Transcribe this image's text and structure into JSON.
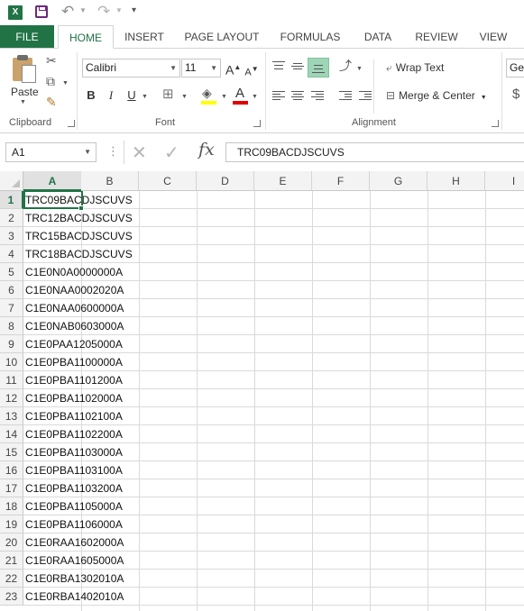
{
  "app": {
    "logo": "X"
  },
  "ribbon_tabs": [
    {
      "label": "FILE"
    },
    {
      "label": "HOME"
    },
    {
      "label": "INSERT"
    },
    {
      "label": "PAGE LAYOUT"
    },
    {
      "label": "FORMULAS"
    },
    {
      "label": "DATA"
    },
    {
      "label": "REVIEW"
    },
    {
      "label": "VIEW"
    }
  ],
  "clipboard": {
    "paste_label": "Paste",
    "group_label": "Clipboard"
  },
  "font": {
    "name": "Calibri",
    "size": "11",
    "group_label": "Font",
    "bold": "B",
    "italic": "I",
    "underline": "U",
    "grow": "A",
    "shrink": "A",
    "font_color_letter": "A",
    "highlight_color": "#ffff00",
    "font_color": "#e00000"
  },
  "alignment": {
    "wrap_text": "Wrap Text",
    "merge_center": "Merge & Center",
    "group_label": "Alignment"
  },
  "number": {
    "format": "General",
    "currency": "$"
  },
  "formula_bar": {
    "name_box": "A1",
    "fx": "fx",
    "value": "TRC09BACDJSCUVS"
  },
  "columns": [
    "A",
    "B",
    "C",
    "D",
    "E",
    "F",
    "G",
    "H",
    "I"
  ],
  "rows": [
    {
      "num": "1",
      "a": "TRC09BACDJSCUVS"
    },
    {
      "num": "2",
      "a": "TRC12BACDJSCUVS"
    },
    {
      "num": "3",
      "a": "TRC15BACDJSCUVS"
    },
    {
      "num": "4",
      "a": "TRC18BACDJSCUVS"
    },
    {
      "num": "5",
      "a": "C1E0N0A0000000A"
    },
    {
      "num": "6",
      "a": "C1E0NAA0002020A"
    },
    {
      "num": "7",
      "a": "C1E0NAA0600000A"
    },
    {
      "num": "8",
      "a": "C1E0NAB0603000A"
    },
    {
      "num": "9",
      "a": "C1E0PAA1205000A"
    },
    {
      "num": "10",
      "a": "C1E0PBA1100000A"
    },
    {
      "num": "11",
      "a": "C1E0PBA1101200A"
    },
    {
      "num": "12",
      "a": "C1E0PBA1102000A"
    },
    {
      "num": "13",
      "a": "C1E0PBA1102100A"
    },
    {
      "num": "14",
      "a": "C1E0PBA1102200A"
    },
    {
      "num": "15",
      "a": "C1E0PBA1103000A"
    },
    {
      "num": "16",
      "a": "C1E0PBA1103100A"
    },
    {
      "num": "17",
      "a": "C1E0PBA1103200A"
    },
    {
      "num": "18",
      "a": "C1E0PBA1105000A"
    },
    {
      "num": "19",
      "a": "C1E0PBA1106000A"
    },
    {
      "num": "20",
      "a": "C1E0RAA1602000A"
    },
    {
      "num": "21",
      "a": "C1E0RAA1605000A"
    },
    {
      "num": "22",
      "a": "C1E0RBA1302010A"
    },
    {
      "num": "23",
      "a": "C1E0RBA1402010A"
    }
  ]
}
